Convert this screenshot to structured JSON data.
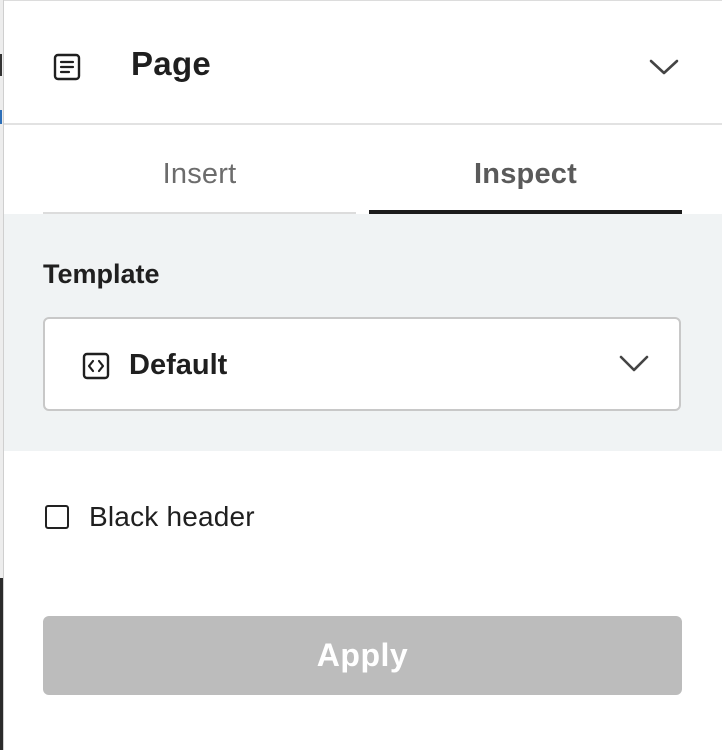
{
  "header": {
    "title": "Page",
    "icon": "page-icon",
    "collapse_icon": "chevron-down-icon"
  },
  "tabs": [
    {
      "label": "Insert",
      "active": false
    },
    {
      "label": "Inspect",
      "active": true
    }
  ],
  "template": {
    "label": "Template",
    "selected": "Default",
    "icon": "code-icon",
    "dropdown_icon": "chevron-down-icon"
  },
  "options": {
    "black_header": {
      "label": "Black header",
      "checked": false
    }
  },
  "actions": {
    "apply_label": "Apply",
    "apply_enabled": false
  },
  "colors": {
    "section_background": "#f0f3f4",
    "active_tab_underline": "#1c1c1c",
    "button_disabled": "#bcbcbc"
  }
}
